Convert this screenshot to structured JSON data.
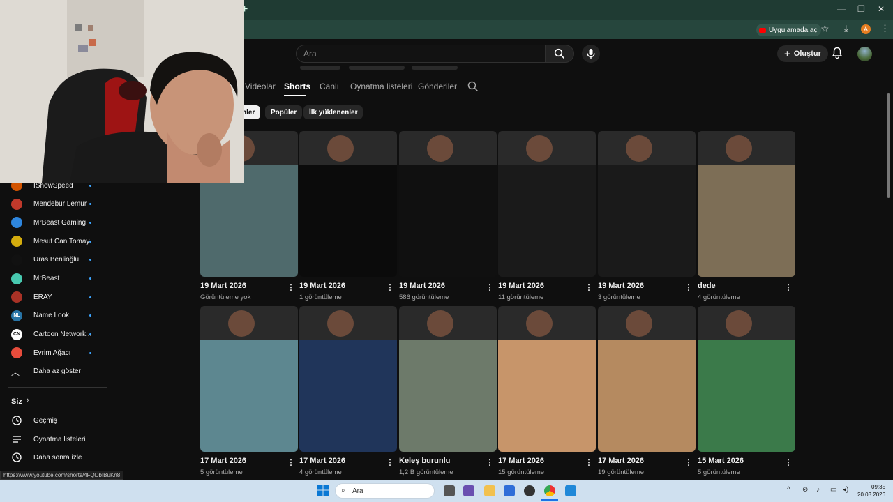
{
  "browser": {
    "open_in_app": "Uygulamada aç",
    "profile_initial": "A",
    "new_tab": "+",
    "window_controls": [
      "—",
      "❐",
      "✕"
    ]
  },
  "header": {
    "search_placeholder": "Ara",
    "create_label": "Oluştur"
  },
  "tabs": [
    {
      "label": "Videolar",
      "active": false
    },
    {
      "label": "Shorts",
      "active": true
    },
    {
      "label": "Canlı",
      "active": false
    },
    {
      "label": "Oynatma listeleri",
      "active": false
    },
    {
      "label": "Gönderiler",
      "active": false
    }
  ],
  "chips": [
    "nler",
    "Popüler",
    "İlk yüklenenler"
  ],
  "sidebar": {
    "subscriptions": [
      {
        "name": "IShowSpeed",
        "color": "#d35400"
      },
      {
        "name": "Mendebur Lemur",
        "color": "#c0392b"
      },
      {
        "name": "MrBeast Gaming",
        "color": "#2e86de"
      },
      {
        "name": "Mesut Can Tomay",
        "color": "#d4ac0d"
      },
      {
        "name": "Uras Benlioğlu",
        "color": "#111111"
      },
      {
        "name": "MrBeast",
        "color": "#48c9b0"
      },
      {
        "name": "ERAY",
        "color": "#a93226"
      },
      {
        "name": "Name Look",
        "color": "#2874a6",
        "initials": "NL"
      },
      {
        "name": "Cartoon Network...",
        "color": "#ffffff",
        "initials": "CN"
      },
      {
        "name": "Evrim Ağacı",
        "color": "#e74c3c"
      }
    ],
    "show_less": "Daha az göster",
    "you_section": "Siz",
    "you_items": [
      "Geçmiş",
      "Oynatma listeleri",
      "Daha sonra izle"
    ]
  },
  "shorts": [
    {
      "title": "19 Mart 2026",
      "views": "Görüntüleme yok",
      "thumb": "#4f6a6c"
    },
    {
      "title": "19 Mart 2026",
      "views": "1 görüntüleme",
      "thumb": "#0b0b0b"
    },
    {
      "title": "19 Mart 2026",
      "views": "586 görüntüleme",
      "thumb": "#101010"
    },
    {
      "title": "19 Mart 2026",
      "views": "11 görüntüleme",
      "thumb": "#1a1a1a"
    },
    {
      "title": "19 Mart 2026",
      "views": "3 görüntüleme",
      "thumb": "#1a1a1a"
    },
    {
      "title": "dede",
      "views": "4 görüntüleme",
      "thumb": "#7d6e56"
    },
    {
      "title": "17 Mart 2026",
      "views": "5 görüntüleme",
      "thumb": "#5d8790"
    },
    {
      "title": "17 Mart 2026",
      "views": "4 görüntüleme",
      "thumb": "#20355a"
    },
    {
      "title": "Keleş burunlu",
      "views": "1,2 B görüntüleme",
      "thumb": "#6d7a6a"
    },
    {
      "title": "17 Mart 2026",
      "views": "15 görüntüleme",
      "thumb": "#c7956a"
    },
    {
      "title": "17 Mart 2026",
      "views": "19 görüntüleme",
      "thumb": "#b58a60"
    },
    {
      "title": "15 Mart 2026",
      "views": "5 görüntüleme",
      "thumb": "#3b7a4a"
    }
  ],
  "status_url": "https://www.youtube.com/shorts/4FQDbIBuKn8",
  "taskbar": {
    "search": "Ara",
    "time": "09:35",
    "date": "20.03.2026"
  }
}
